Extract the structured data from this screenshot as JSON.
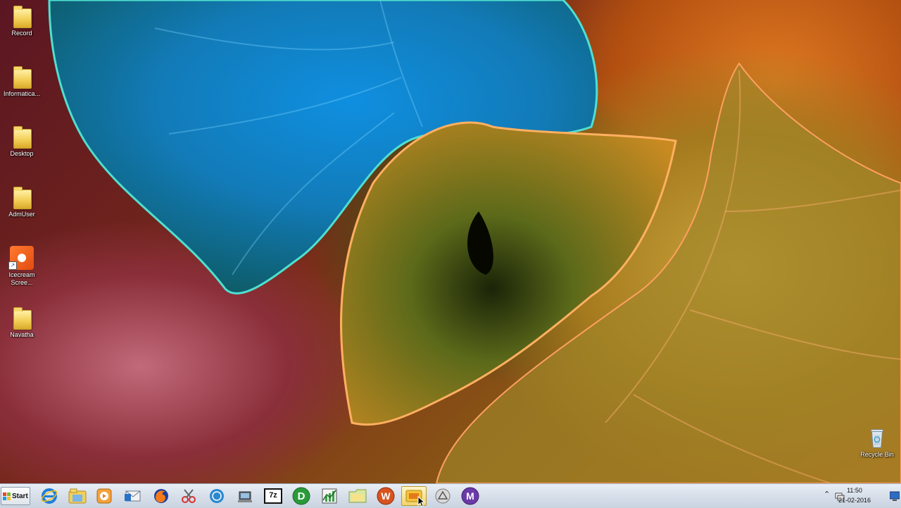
{
  "desktop": {
    "icons": [
      {
        "label": "Record",
        "type": "folder-icon"
      },
      {
        "label": "Informatica...",
        "type": "folder-icon"
      },
      {
        "label": "Desktop",
        "type": "folder-icon"
      },
      {
        "label": "AdmUser",
        "type": "folder-icon"
      },
      {
        "label": "Icecream Scree...",
        "type": "icecream-screen-recorder-icon"
      },
      {
        "label": "Navatha",
        "type": "folder-icon"
      }
    ],
    "recycle_bin": {
      "label": "Recycle Bin"
    }
  },
  "taskbar": {
    "start_label": "Start",
    "pinned": [
      "internet-explorer-icon",
      "windows-explorer-icon",
      "media-player-icon",
      "outlook-icon",
      "firefox-icon",
      "snipping-tool-icon",
      "jabber-icon",
      "computer-admin-icon",
      "7zip-icon",
      "d-app-icon",
      "task-manager-icon",
      "explorer-folder-icon",
      "w-app-icon",
      "active-window-icon",
      "network-map-icon",
      "m-app-icon"
    ],
    "sevenzip_label": "7z",
    "d_label": "D",
    "w_label": "W",
    "m_label": "M",
    "clock": {
      "time": "11:50",
      "date": "21-02-2016"
    }
  }
}
